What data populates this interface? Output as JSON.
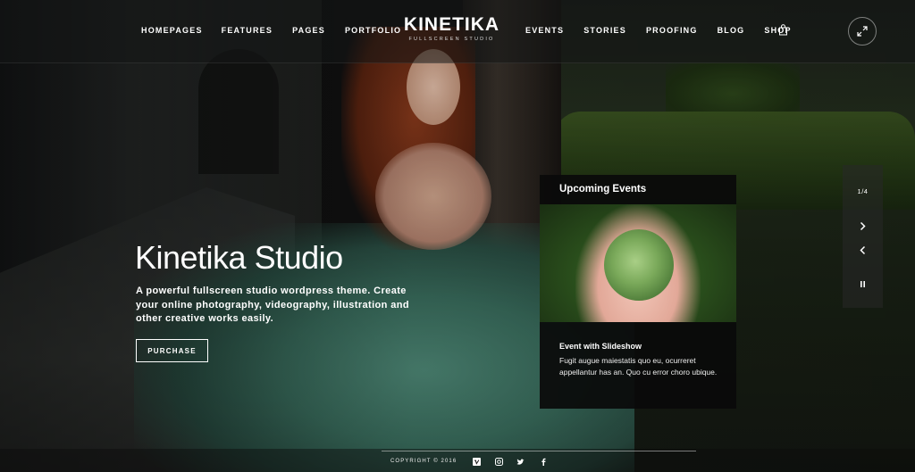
{
  "header": {
    "nav_left": [
      "HOMEPAGES",
      "FEATURES",
      "PAGES",
      "PORTFOLIO"
    ],
    "nav_right": [
      "EVENTS",
      "STORIES",
      "PROOFING",
      "BLOG",
      "SHOP"
    ],
    "logo_title": "KINETIKA",
    "logo_subtitle": "FULLSCREEN STUDIO",
    "icons": {
      "cart": "shopping-bag-icon",
      "fullscreen": "expand-icon"
    }
  },
  "hero": {
    "title": "Kinetika Studio",
    "description": "A powerful fullscreen studio wordpress theme. Create your online photography, videography, illustration and other creative works easily.",
    "button": "PURCHASE"
  },
  "events": {
    "heading": "Upcoming Events",
    "item_title": "Event with Slideshow",
    "item_desc": "Fugit augue maiestatis quo eu, ocurreret appellantur has an. Quo cu error choro ubique."
  },
  "slider": {
    "counter": "1/4",
    "icons": [
      "next-arrow-icon",
      "prev-arrow-icon",
      "pause-icon"
    ]
  },
  "footer": {
    "copyright": "COPYRIGHT © 2016",
    "social_icons": [
      "vimeo-icon",
      "instagram-icon",
      "twitter-icon",
      "facebook-icon"
    ]
  },
  "colors": {
    "panel_bg": "#0a0a0a",
    "accent_text": "#ffffff"
  }
}
